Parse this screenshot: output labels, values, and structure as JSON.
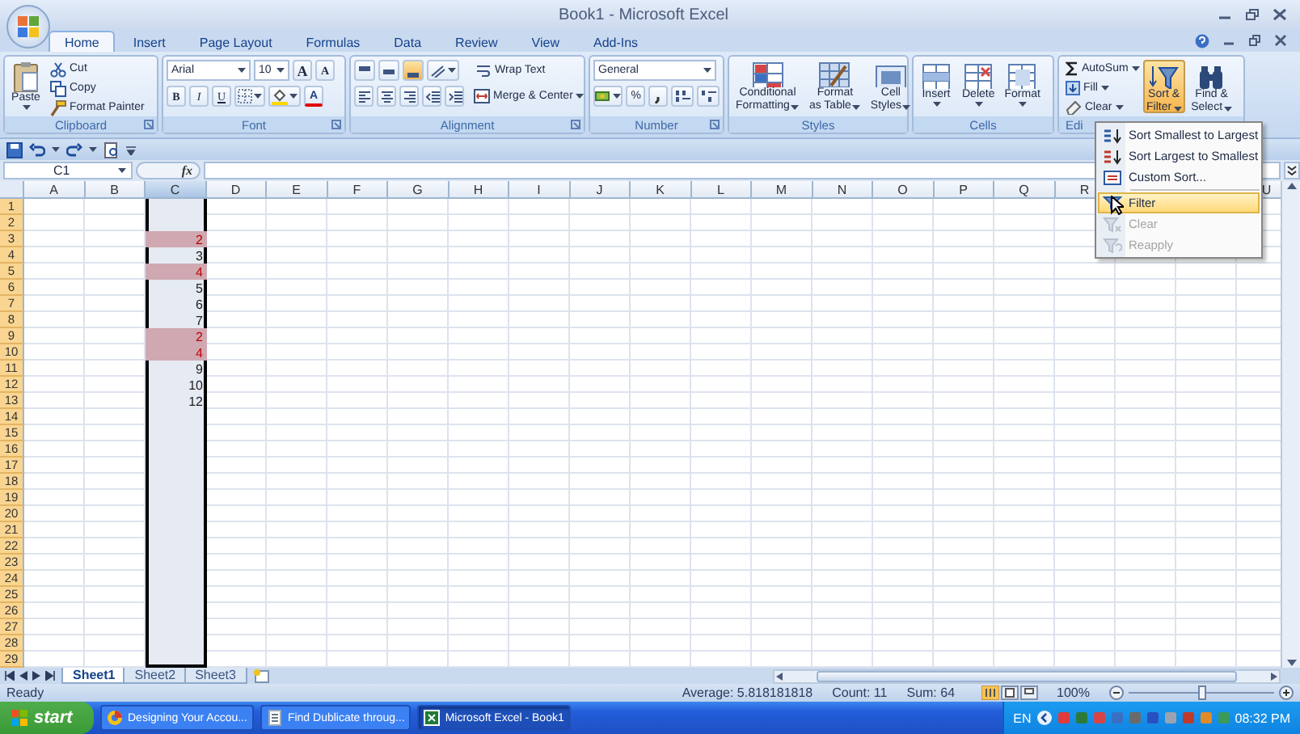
{
  "window": {
    "title": "Book1 - Microsoft Excel"
  },
  "tabs": [
    {
      "label": "Home",
      "selected": true
    },
    {
      "label": "Insert",
      "selected": false
    },
    {
      "label": "Page Layout",
      "selected": false
    },
    {
      "label": "Formulas",
      "selected": false
    },
    {
      "label": "Data",
      "selected": false
    },
    {
      "label": "Review",
      "selected": false
    },
    {
      "label": "View",
      "selected": false
    },
    {
      "label": "Add-Ins",
      "selected": false
    }
  ],
  "ribbon": {
    "clipboard": {
      "label": "Clipboard",
      "paste": "Paste",
      "cut": "Cut",
      "copy": "Copy",
      "format_painter": "Format Painter"
    },
    "font": {
      "label": "Font",
      "name": "Arial",
      "size": "10",
      "grow": "A",
      "shrink": "A",
      "bold": "B",
      "italic": "I",
      "underline": "U",
      "fore": "A"
    },
    "alignment": {
      "label": "Alignment",
      "wrap": "Wrap Text",
      "merge": "Merge & Center"
    },
    "number": {
      "label": "Number",
      "format": "General",
      "percent": "%"
    },
    "styles": {
      "label": "Styles",
      "conditional": [
        "Conditional",
        "Formatting"
      ],
      "table": [
        "Format",
        "as Table"
      ],
      "cell_styles": [
        "Cell",
        "Styles"
      ]
    },
    "cells": {
      "label": "Cells",
      "insert": "Insert",
      "delete": "Delete",
      "format": "Format"
    },
    "editing": {
      "label": "Edi",
      "autosum": "AutoSum",
      "fill": "Fill",
      "clear": "Clear",
      "sort_filter": {
        "lines": [
          "Sort &",
          "Filter"
        ],
        "selected": true
      },
      "find_select": [
        "Find &",
        "Select"
      ]
    }
  },
  "name_box": "C1",
  "function_button": "fx",
  "columns": [
    {
      "label": "A",
      "selected": false
    },
    {
      "label": "B",
      "selected": false
    },
    {
      "label": "C",
      "selected": true,
      "cells": [
        null,
        null,
        {
          "value": "2",
          "duplicate": true
        },
        {
          "value": "3",
          "duplicate": false
        },
        {
          "value": "4",
          "duplicate": true
        },
        {
          "value": "5",
          "duplicate": false
        },
        {
          "value": "6",
          "duplicate": false
        },
        {
          "value": "7",
          "duplicate": false
        },
        {
          "value": "2",
          "duplicate": true
        },
        {
          "value": "4",
          "duplicate": true
        },
        {
          "value": "9",
          "duplicate": false
        },
        {
          "value": "10",
          "duplicate": false
        },
        {
          "value": "12",
          "duplicate": false
        }
      ]
    },
    {
      "label": "D",
      "selected": false
    },
    {
      "label": "E",
      "selected": false
    },
    {
      "label": "F",
      "selected": false
    },
    {
      "label": "G",
      "selected": false
    },
    {
      "label": "H",
      "selected": false
    },
    {
      "label": "I",
      "selected": false
    },
    {
      "label": "J",
      "selected": false
    },
    {
      "label": "K",
      "selected": false
    },
    {
      "label": "L",
      "selected": false
    },
    {
      "label": "M",
      "selected": false
    },
    {
      "label": "N",
      "selected": false
    },
    {
      "label": "O",
      "selected": false
    },
    {
      "label": "P",
      "selected": false
    },
    {
      "label": "Q",
      "selected": false
    },
    {
      "label": "R",
      "selected": false
    },
    null,
    null,
    {
      "label": "U",
      "selected": false
    }
  ],
  "rows": [
    {
      "label": "1",
      "selected": true
    },
    {
      "label": "2",
      "selected": true
    },
    {
      "label": "3",
      "selected": true
    },
    {
      "label": "4",
      "selected": true
    },
    {
      "label": "5",
      "selected": true
    },
    {
      "label": "6",
      "selected": true
    },
    {
      "label": "7",
      "selected": true
    },
    {
      "label": "8",
      "selected": true
    },
    {
      "label": "9",
      "selected": true
    },
    {
      "label": "10",
      "selected": true
    },
    {
      "label": "11",
      "selected": true
    },
    {
      "label": "12",
      "selected": true
    },
    {
      "label": "13",
      "selected": true
    },
    {
      "label": "14",
      "selected": true
    },
    {
      "label": "15",
      "selected": true
    },
    {
      "label": "16",
      "selected": true
    },
    {
      "label": "17",
      "selected": true
    },
    {
      "label": "18",
      "selected": true
    },
    {
      "label": "19",
      "selected": true
    },
    {
      "label": "20",
      "selected": true
    },
    {
      "label": "21",
      "selected": true
    },
    {
      "label": "22",
      "selected": true
    },
    {
      "label": "23",
      "selected": true
    },
    {
      "label": "24",
      "selected": true
    },
    {
      "label": "25",
      "selected": true
    },
    {
      "label": "26",
      "selected": true
    },
    {
      "label": "27",
      "selected": true
    },
    {
      "label": "28",
      "selected": true
    },
    {
      "label": "29",
      "selected": true
    }
  ],
  "sort_menu": {
    "items": [
      {
        "label": "Sort Smallest to Largest",
        "kind": "sort-ascending",
        "selected": false,
        "disabled": false
      },
      {
        "label": "Sort Largest to Smallest",
        "kind": "sort-descending",
        "selected": false,
        "disabled": false
      },
      {
        "label": "Custom Sort...",
        "kind": "custom-sort",
        "selected": false,
        "disabled": false
      },
      {
        "label": "Filter",
        "kind": "filter",
        "selected": true,
        "disabled": false
      },
      {
        "label": "Clear",
        "kind": "clear",
        "selected": false,
        "disabled": true
      },
      {
        "label": "Reapply",
        "kind": "reapply",
        "selected": false,
        "disabled": true
      }
    ]
  },
  "sheet_tabs": [
    {
      "label": "Sheet1",
      "selected": true
    },
    {
      "label": "Sheet2",
      "selected": false
    },
    {
      "label": "Sheet3",
      "selected": false
    }
  ],
  "status_bar": {
    "mode": "Ready",
    "average": "Average: 5.818181818",
    "count": "Count: 11",
    "sum": "Sum: 64",
    "zoom": "100%",
    "zoom_slider": {
      "level": 0.5
    }
  },
  "taskbar": {
    "start": "start",
    "tasks": [
      {
        "label": "Designing Your Accou...",
        "kind": "browser",
        "selected": false
      },
      {
        "label": "Find Dublicate throug...",
        "kind": "document",
        "selected": false
      },
      {
        "label": "Microsoft Excel - Book1",
        "kind": "excel",
        "selected": true
      }
    ],
    "language": "EN",
    "clock": "08:32 PM"
  }
}
